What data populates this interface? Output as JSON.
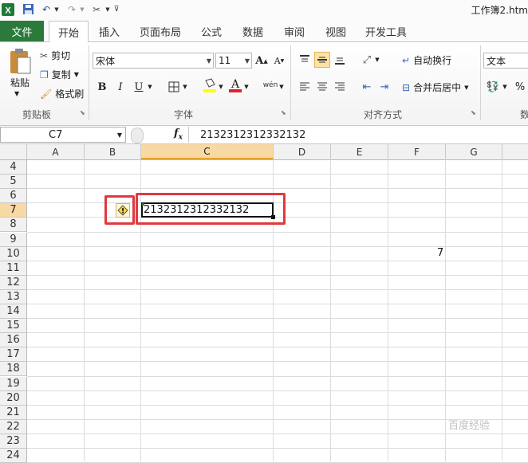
{
  "window": {
    "title": "工作簿2.htm"
  },
  "quick_access": {
    "icons": [
      "excel-logo-icon",
      "save-icon",
      "undo-icon",
      "redo-icon",
      "tools-icon",
      "customize-icon"
    ]
  },
  "tabs": [
    {
      "label": "文件",
      "active": false,
      "file": true
    },
    {
      "label": "开始",
      "active": true
    },
    {
      "label": "插入",
      "active": false
    },
    {
      "label": "页面布局",
      "active": false
    },
    {
      "label": "公式",
      "active": false
    },
    {
      "label": "数据",
      "active": false
    },
    {
      "label": "审阅",
      "active": false
    },
    {
      "label": "视图",
      "active": false
    },
    {
      "label": "开发工具",
      "active": false
    }
  ],
  "ribbon": {
    "clipboard": {
      "paste": "粘贴",
      "cut": "剪切",
      "copy": "复制",
      "format_painter": "格式刷",
      "group": "剪贴板"
    },
    "font": {
      "name": "宋体",
      "size": "11",
      "group": "字体",
      "bold": "B",
      "italic": "I",
      "underline": "U",
      "grow": "A",
      "shrink": "A"
    },
    "alignment": {
      "wrap": "自动换行",
      "merge": "合并后居中",
      "group": "对齐方式"
    },
    "number": {
      "format": "文本",
      "group": "数"
    }
  },
  "formula_bar": {
    "name_box": "C7",
    "fx": "fx",
    "value": "2132312312332132"
  },
  "columns": [
    "A",
    "B",
    "C",
    "D",
    "E",
    "F",
    "G"
  ],
  "selected_column": "C",
  "rows": [
    "4",
    "5",
    "6",
    "7",
    "8",
    "9",
    "10",
    "11",
    "12",
    "13",
    "14",
    "15",
    "16",
    "17",
    "18",
    "19",
    "20",
    "21",
    "22",
    "23",
    "24"
  ],
  "selected_row": "7",
  "cells": {
    "C7": "2132312312332132",
    "F10": "7"
  },
  "error_indicator": "!",
  "watermark": "百度经验",
  "colors": {
    "file_tab": "#2c7a3b",
    "highlight": "#f9d9a3",
    "annotation": "#e0393e"
  }
}
